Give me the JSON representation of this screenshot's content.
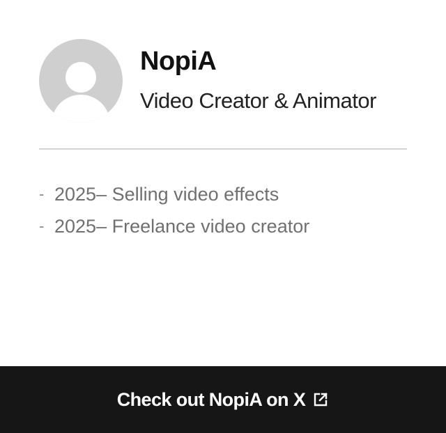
{
  "profile": {
    "name": "NopiA",
    "role": "Video Creator & Animator",
    "avatar_icon": "default-user-avatar-icon"
  },
  "timeline": [
    {
      "text": "2025– Selling video effects"
    },
    {
      "text": "2025– Freelance video creator"
    }
  ],
  "footer": {
    "label": "Check out NopiA on X",
    "icon": "external-link-icon"
  },
  "colors": {
    "avatar_bg": "#cfcfcf",
    "footer_bg": "#161616",
    "divider": "#d4d4d4",
    "timeline_text": "#707070"
  }
}
